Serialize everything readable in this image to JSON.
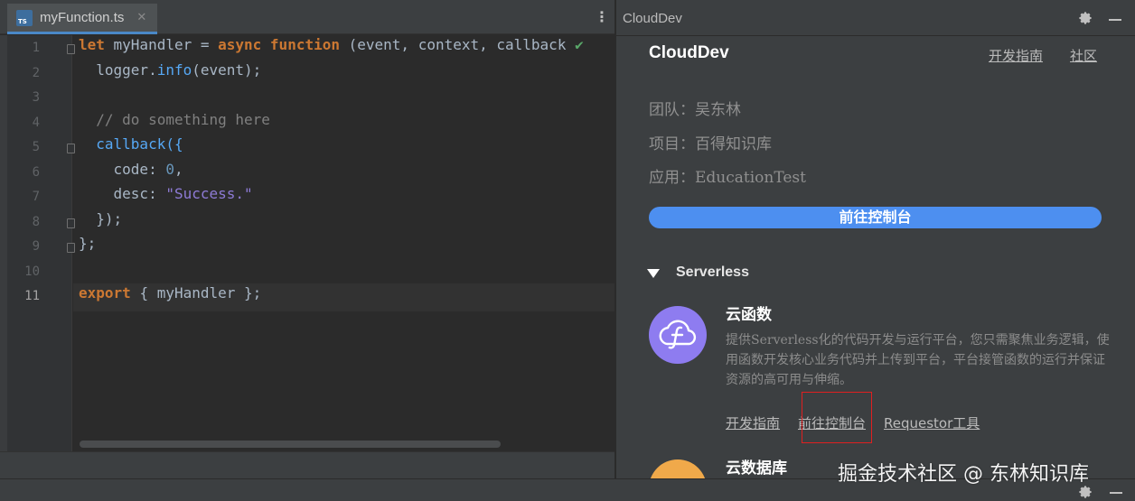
{
  "editor": {
    "tab": {
      "icon_text": "TS",
      "label": "myFunction.ts",
      "close": "✕"
    },
    "more_menu": "⋮",
    "line_numbers": [
      "1",
      "2",
      "3",
      "4",
      "5",
      "6",
      "7",
      "8",
      "9",
      "10",
      "11"
    ],
    "code_lines": [
      [
        {
          "t": "let ",
          "c": "kw"
        },
        {
          "t": "myHandler = ",
          "c": ""
        },
        {
          "t": "async ",
          "c": "kw"
        },
        {
          "t": "function ",
          "c": "kw"
        },
        {
          "t": "(event, context, callback ",
          "c": ""
        },
        {
          "t": "✔",
          "c": "ok"
        }
      ],
      [
        {
          "t": "  logger.",
          "c": ""
        },
        {
          "t": "info",
          "c": "mth"
        },
        {
          "t": "(event);",
          "c": ""
        }
      ],
      [],
      [
        {
          "t": "  // do something here",
          "c": "cmt"
        }
      ],
      [
        {
          "t": "  callback({",
          "c": "mth"
        }
      ],
      [
        {
          "t": "    code: ",
          "c": ""
        },
        {
          "t": "0",
          "c": "num"
        },
        {
          "t": ",",
          "c": ""
        }
      ],
      [
        {
          "t": "    desc: ",
          "c": ""
        },
        {
          "t": "\"Success.\"",
          "c": "str"
        }
      ],
      [
        {
          "t": "  });",
          "c": ""
        }
      ],
      [
        {
          "t": "};",
          "c": ""
        }
      ],
      [],
      [
        {
          "t": "export ",
          "c": "kw"
        },
        {
          "t": "{ myHandler };",
          "c": ""
        }
      ]
    ],
    "current_line": 11
  },
  "panel": {
    "title": "CloudDev",
    "brand": "CloudDev",
    "links": {
      "guide": "开发指南",
      "community": "社区"
    },
    "info": {
      "team": "团队：吴东林",
      "project": "项目：百得知识库",
      "app": "应用：EducationTest"
    },
    "console_button": "前往控制台",
    "section": {
      "title": "Serverless"
    },
    "services": [
      {
        "name": "云函数",
        "description": "提供Serverless化的代码开发与运行平台，您只需聚焦业务逻辑，使用函数开发核心业务代码并上传到平台，平台接管函数的运行并保证资源的高可用与伸缩。",
        "links": [
          "开发指南",
          "前往控制台",
          "Requestor工具"
        ]
      },
      {
        "name": "云数据库"
      }
    ]
  },
  "watermark": "掘金技术社区 @ 东林知识库",
  "colors": {
    "accent": "#4d8ff0",
    "function_icon": "#8e7cf0",
    "db_icon": "#f0a94a",
    "highlight": "#e02020"
  }
}
